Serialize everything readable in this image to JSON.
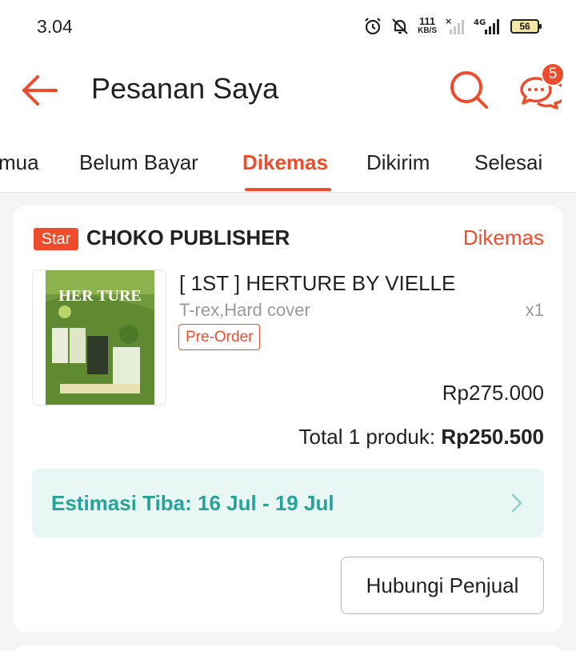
{
  "status_bar": {
    "time": "3.04",
    "net_speed_value": "111",
    "net_speed_unit": "KB/S",
    "network_type": "4G",
    "battery": "56",
    "icons": [
      "alarm-icon",
      "notifications-off-icon",
      "no-signal-icon",
      "signal-icon",
      "battery-icon"
    ]
  },
  "header": {
    "title": "Pesanan Saya",
    "back_icon": "arrow-left-icon",
    "search_icon": "search-icon",
    "chat_icon": "chat-icon",
    "chat_badge": "5"
  },
  "tabs": [
    {
      "label": "mua",
      "active": false
    },
    {
      "label": "Belum Bayar",
      "active": false
    },
    {
      "label": "Dikemas",
      "active": true
    },
    {
      "label": "Dikirim",
      "active": false
    },
    {
      "label": "Selesai",
      "active": false
    }
  ],
  "order": {
    "shop_badge": "Star",
    "shop_name": "CHOKO PUBLISHER",
    "status": "Dikemas",
    "product": {
      "name": "[ 1ST ] HERTURE BY VIELLE",
      "variant": "T-rex,Hard cover",
      "quantity": "x1",
      "tag": "Pre-Order",
      "price": "Rp275.000",
      "thumb_text": "HER TURE"
    },
    "total_label": "Total 1 produk:",
    "total_amount": "Rp250.500",
    "estimate": "Estimasi Tiba: 16 Jul - 19 Jul",
    "contact_button": "Hubungi Penjual"
  },
  "colors": {
    "accent": "#ee4d2d",
    "estimate_bg": "#e8f7f4",
    "estimate_text": "#26a396",
    "muted_text": "#9a9a9a"
  }
}
